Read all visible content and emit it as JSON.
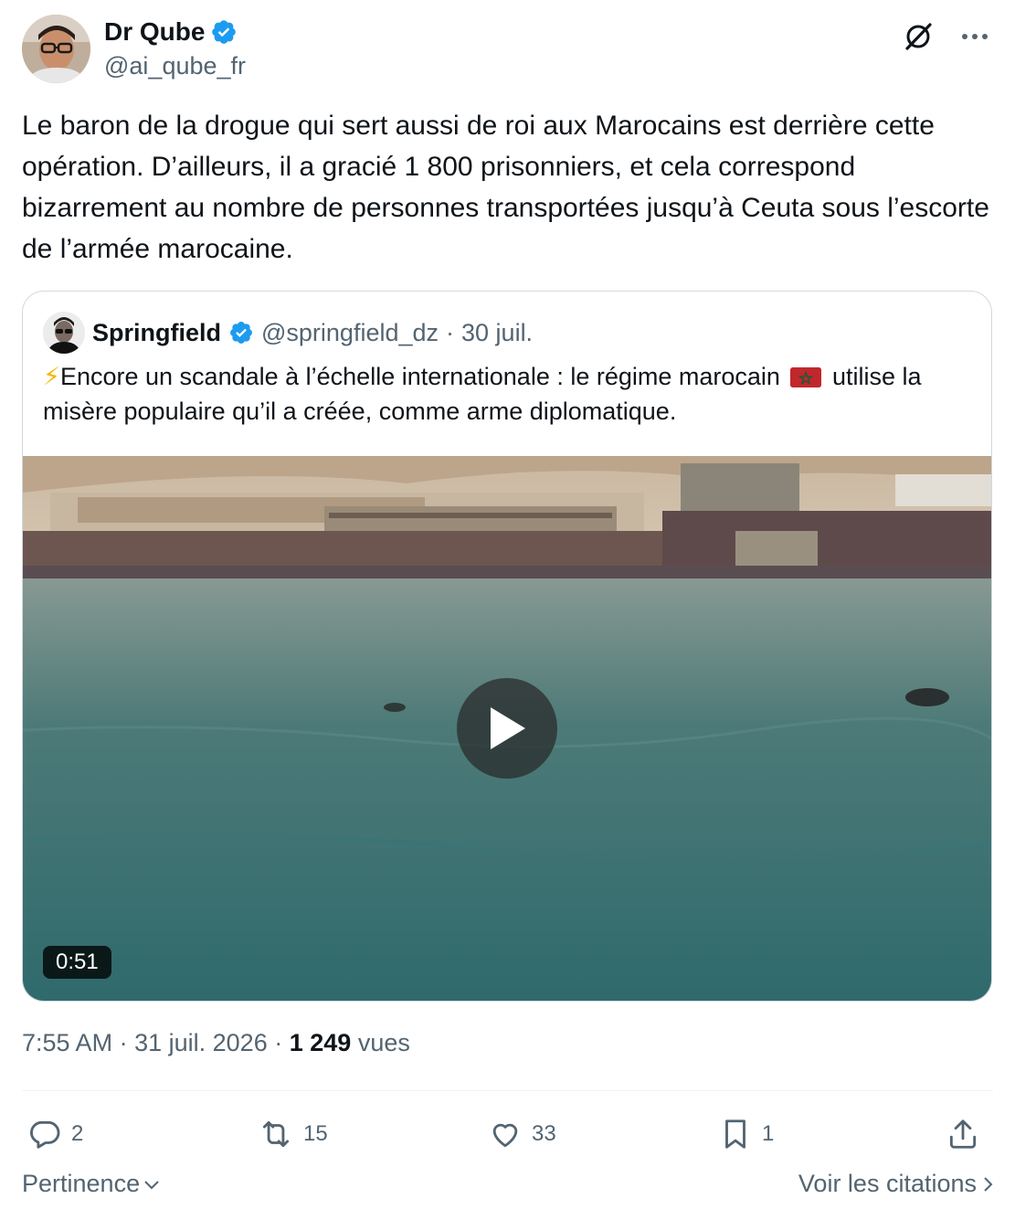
{
  "author": {
    "name": "Dr Qube",
    "handle": "@ai_qube_fr"
  },
  "tweet": {
    "text": "Le baron de la drogue qui sert aussi de roi aux Marocains est derrière cette opération. D’ailleurs, il a gracié 1 800 prisonniers, et cela correspond bizarrement au nombre de personnes transportées jusqu’à Ceuta sous l’escorte de l’armée marocaine."
  },
  "quote": {
    "name": "Springfield",
    "handle": "@springfield_dz",
    "separator": "·",
    "date": "30 juil.",
    "emoji": "⚡",
    "text_before_flag": "Encore un scandale à l’échelle internationale : le régime marocain",
    "text_after_flag": "utilise la misère populaire qu’il a créée, comme arme diplomatique.",
    "video_duration": "0:51"
  },
  "meta": {
    "time": "7:55 AM",
    "sep1": "·",
    "date": "31 juil. 2026",
    "sep2": "·",
    "views_count": "1 249",
    "views_label": "vues"
  },
  "actions": {
    "replies": "2",
    "reposts": "15",
    "likes": "33",
    "bookmarks": "1"
  },
  "footer": {
    "sort_label": "Pertinence",
    "quotes_label": "Voir les citations"
  },
  "colors": {
    "verified": "#1d9bf0",
    "secondary_text": "#536471",
    "border": "#cfd9de",
    "flag_red": "#c1272d",
    "flag_green": "#006233"
  }
}
